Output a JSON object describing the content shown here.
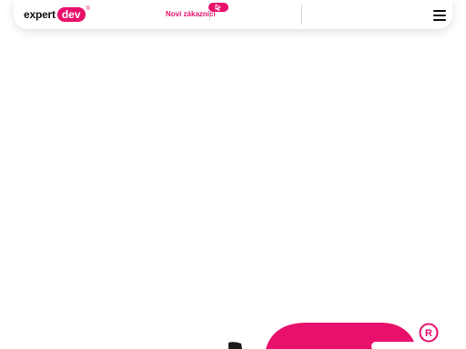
{
  "brand": {
    "logo_prefix": "expert",
    "logo_pill": "dev",
    "logo_reg": "®",
    "accent": "#e8106a"
  },
  "nav": {
    "new_customers": "Noví zákazníci",
    "badge_icon": "cursor-hand-icon",
    "menu_icon": "hamburger-menu-icon"
  },
  "hero": {
    "reg_mark": "®"
  }
}
